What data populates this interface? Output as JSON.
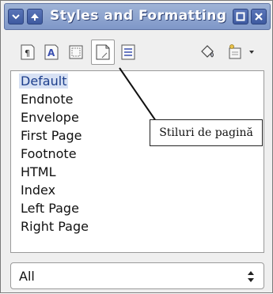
{
  "window": {
    "title": "Styles and Formatting"
  },
  "toolbar": {
    "items": [
      {
        "icon": "paragraph-styles-icon"
      },
      {
        "icon": "character-styles-icon"
      },
      {
        "icon": "frame-styles-icon"
      },
      {
        "icon": "page-styles-icon",
        "active": true
      },
      {
        "icon": "list-styles-icon"
      },
      {
        "icon": "fill-format-mode-icon"
      },
      {
        "icon": "new-style-from-selection-icon"
      }
    ]
  },
  "styles_list": {
    "items": [
      "Default",
      "Endnote",
      "Envelope",
      "First Page",
      "Footnote",
      "HTML",
      "Index",
      "Left Page",
      "Right Page"
    ],
    "selected": "Default"
  },
  "callout": {
    "text": "Stiluri de pagină"
  },
  "filter": {
    "value": "All"
  },
  "colors": {
    "titlebar": "#8aa0d0",
    "accent": "#3e5aa0",
    "selection": "#d7e1f4"
  }
}
